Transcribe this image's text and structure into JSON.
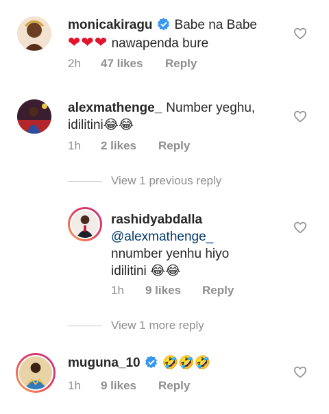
{
  "comments": [
    {
      "username": "monicakiragu",
      "verified": true,
      "text_line1": "Babe na Babe",
      "hearts": "❤❤❤",
      "text_line2": "nawapenda bure",
      "time": "2h",
      "likes": "47 likes",
      "reply": "Reply"
    },
    {
      "username": "alexmathenge_",
      "verified": false,
      "text_line1": "Number yeghu,",
      "text_line2": "idilitini",
      "emojis": "😂😂",
      "time": "1h",
      "likes": "2 likes",
      "reply": "Reply"
    },
    {
      "username": "rashidyabdalla",
      "verified": false,
      "mention": "@alexmathenge_",
      "text_line1": "nnumber yenhu hiyo",
      "text_line2": "idilitini",
      "emojis": "😂😂",
      "time": "1h",
      "likes": "9 likes",
      "reply": "Reply"
    },
    {
      "username": "muguna_10",
      "verified": true,
      "emojis": "🤣🤣🤣",
      "time": "1h",
      "likes": "9 likes",
      "reply": "Reply"
    }
  ],
  "view_previous": "View 1 previous reply",
  "view_more": "View 1 more reply",
  "icons": {
    "like": "heart-outline-icon",
    "verified": "verified-badge-icon"
  },
  "colors": {
    "text": "#262626",
    "meta": "#8e8e8e",
    "mention": "#00376b",
    "verified": "#3897f0",
    "heart": "#e0142c"
  }
}
